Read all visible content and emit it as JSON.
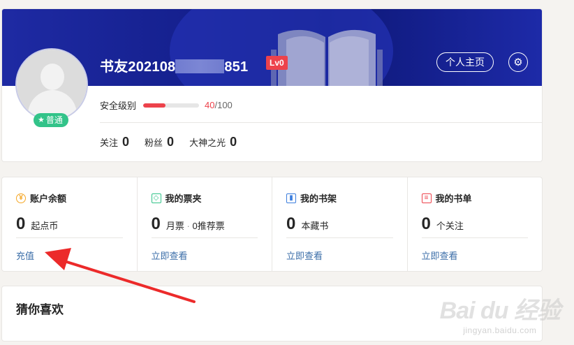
{
  "profile": {
    "username_prefix": "书友202108",
    "username_suffix": "851",
    "level": "Lv0",
    "grade": "普通",
    "homepage_label": "个人主页",
    "security_label": "安全级别",
    "security_score": "40",
    "security_total": "/100",
    "security_fraction": 0.4,
    "stats": [
      {
        "label": "关注",
        "value": "0"
      },
      {
        "label": "粉丝",
        "value": "0"
      },
      {
        "label": "大神之光",
        "value": "0"
      }
    ]
  },
  "wallet": [
    {
      "title": "账户余额",
      "icon": "yuan-icon",
      "value": "0",
      "unit": "起点币",
      "link": "充值"
    },
    {
      "title": "我的票夹",
      "icon": "ticket-icon",
      "value": "0",
      "unit": "月票",
      "sep": "·",
      "unit2": "0推荐票",
      "link": "立即查看"
    },
    {
      "title": "我的书架",
      "icon": "bookshelf-icon",
      "value": "0",
      "unit": "本藏书",
      "link": "立即查看"
    },
    {
      "title": "我的书单",
      "icon": "booklist-icon",
      "value": "0",
      "unit": "个关注",
      "link": "立即查看"
    }
  ],
  "guess": {
    "title": "猜你喜欢"
  },
  "watermark": {
    "main": "Bai du 经验",
    "sub": "jingyan.baidu.com"
  },
  "colors": {
    "accent_red": "#ed424b",
    "banner_blue": "#15208e",
    "link_blue": "#3b6ea8",
    "grade_green": "#32c389"
  }
}
